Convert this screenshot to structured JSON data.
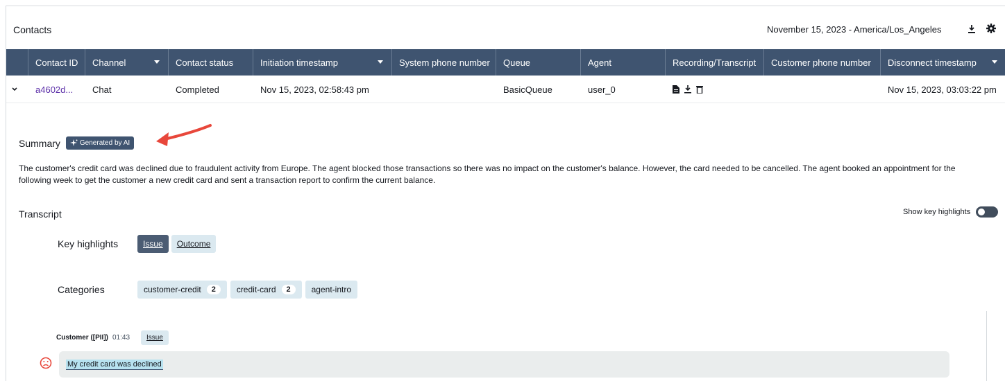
{
  "header": {
    "title": "Contacts",
    "date_range": "November 15, 2023 - America/Los_Angeles",
    "download_icon": "download-icon",
    "settings_icon": "gear-icon"
  },
  "table": {
    "columns": [
      "Contact ID",
      "Channel",
      "Contact status",
      "Initiation timestamp",
      "System phone number",
      "Queue",
      "Agent",
      "Recording/Transcript",
      "Customer phone number",
      "Disconnect timestamp"
    ],
    "row": {
      "contact_id": "a4602d...",
      "channel": "Chat",
      "status": "Completed",
      "initiation": "Nov 15, 2023, 02:58:43 pm",
      "system_phone": "",
      "queue": "BasicQueue",
      "agent": "user_0",
      "customer_phone": "",
      "disconnect": "Nov 15, 2023, 03:03:22 pm"
    }
  },
  "summary": {
    "label": "Summary",
    "badge": "Generated by AI",
    "text": "The customer's credit card was declined due to fraudulent activity from Europe. The agent blocked those transactions so there was no impact on the customer's balance. However, the card needed to be cancelled. The agent booked an appointment for the following week to get the customer a new credit card and sent a transaction report to confirm the current balance."
  },
  "transcript": {
    "label": "Transcript",
    "show_key_highlights": "Show key highlights",
    "key_highlights_label": "Key highlights",
    "highlights": [
      "Issue",
      "Outcome"
    ],
    "categories_label": "Categories",
    "categories": [
      {
        "name": "customer-credit",
        "count": "2"
      },
      {
        "name": "credit-card",
        "count": "2"
      },
      {
        "name": "agent-intro",
        "count": ""
      }
    ],
    "message": {
      "speaker": "Customer ([PII])",
      "time": "01:43",
      "tag": "Issue",
      "text": "My credit card was declined",
      "sentiment_icon": "frown-face-icon"
    }
  },
  "colors": {
    "header_bg": "#3f5470",
    "link": "#5b2ea8",
    "pill_bg": "#dbe9f0",
    "arrow": "#e8473b"
  }
}
